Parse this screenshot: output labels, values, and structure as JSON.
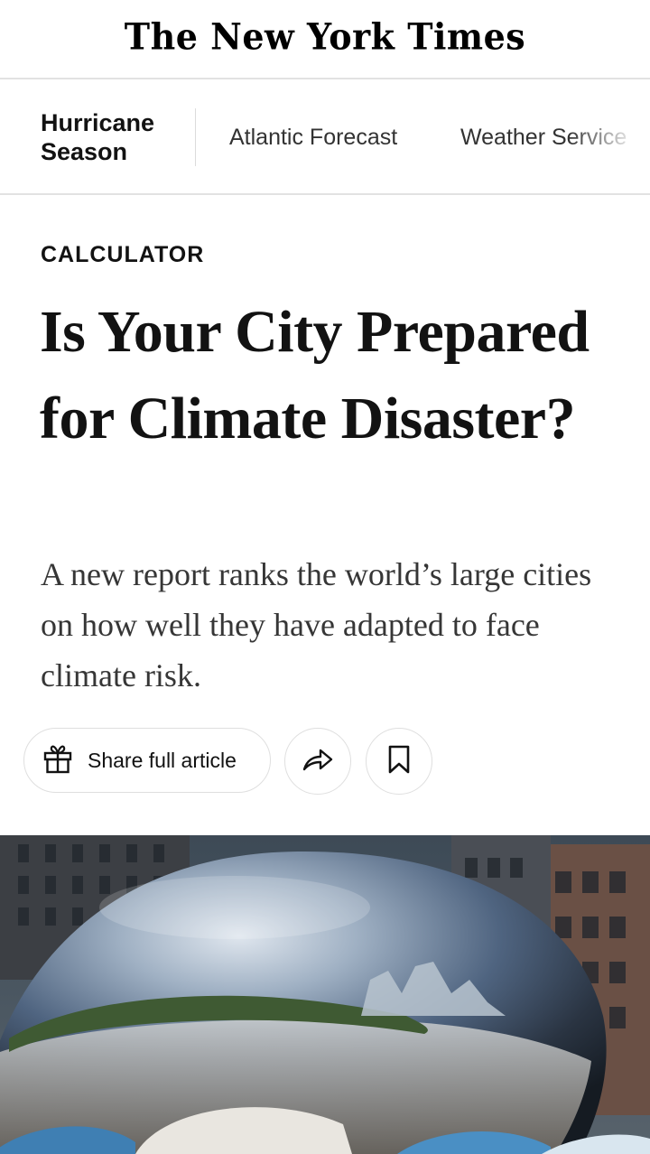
{
  "masthead": {
    "logo_text": "The New York Times"
  },
  "section_nav": {
    "section_label": "Hurricane Season",
    "links": [
      "Atlantic Forecast",
      "Weather Service"
    ]
  },
  "article": {
    "kicker": "CALCULATOR",
    "headline": "Is Your City Prepared for Climate Disaster?",
    "summary": "A new report ranks the world’s large cities on how well they have adapted to face climate risk."
  },
  "share_bar": {
    "share_label": "Share full article",
    "forward_icon": "forward-arrow-icon",
    "save_icon": "bookmark-icon",
    "gift_icon": "gift-icon"
  }
}
